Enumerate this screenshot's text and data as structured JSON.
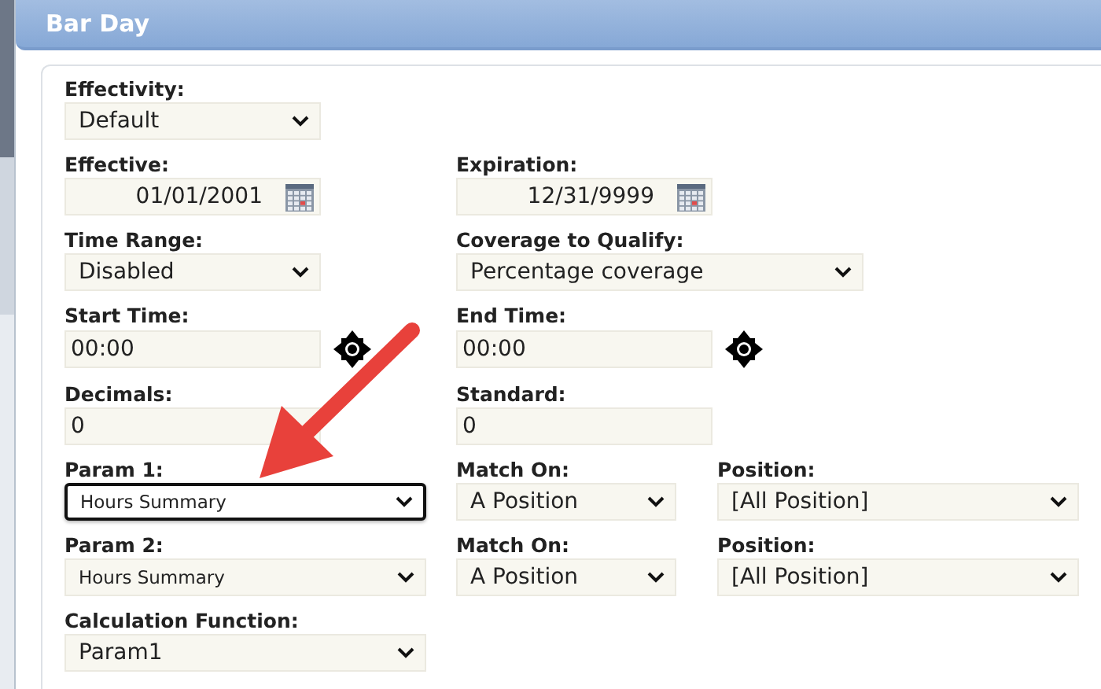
{
  "header": {
    "title": "Bar Day"
  },
  "rows": [
    {
      "fields": [
        {
          "label": "Effectivity:",
          "kind": "select",
          "value": "Default",
          "focused": false
        }
      ]
    },
    {
      "fields": [
        {
          "label": "Effective:",
          "kind": "date",
          "value": "01/01/2001",
          "focused": false
        },
        {
          "label": "Expiration:",
          "kind": "date",
          "value": "12/31/9999",
          "focused": false
        }
      ]
    },
    {
      "fields": [
        {
          "label": "Time Range:",
          "kind": "select",
          "value": "Disabled",
          "focused": false
        },
        {
          "label": "Coverage to Qualify:",
          "kind": "select",
          "value": "Percentage coverage",
          "focused": false
        }
      ]
    },
    {
      "fields": [
        {
          "label": "Start Time:",
          "kind": "time",
          "value": "00:00",
          "focused": false
        },
        {
          "label": "End Time:",
          "kind": "time",
          "value": "00:00",
          "focused": false
        }
      ]
    },
    {
      "fields": [
        {
          "label": "Decimals:",
          "kind": "text",
          "value": "0",
          "focused": false
        },
        {
          "label": "Standard:",
          "kind": "text",
          "value": "0",
          "focused": false
        }
      ]
    },
    {
      "fields": [
        {
          "label": "Param 1:",
          "kind": "small-select",
          "value": "Hours Summary",
          "focused": true
        },
        {
          "label": "Match On:",
          "kind": "select",
          "value": "A Position",
          "focused": false
        },
        {
          "label": "Position:",
          "kind": "select",
          "value": "[All Position]",
          "focused": false
        }
      ]
    },
    {
      "fields": [
        {
          "label": "Param 2:",
          "kind": "small-select",
          "value": "Hours Summary",
          "focused": false
        },
        {
          "label": "Match On:",
          "kind": "select",
          "value": "A Position",
          "focused": false
        },
        {
          "label": "Position:",
          "kind": "select",
          "value": "[All Position]",
          "focused": false
        }
      ]
    },
    {
      "fields": [
        {
          "label": "Calculation Function:",
          "kind": "select",
          "value": "Param1",
          "focused": false
        }
      ]
    }
  ]
}
